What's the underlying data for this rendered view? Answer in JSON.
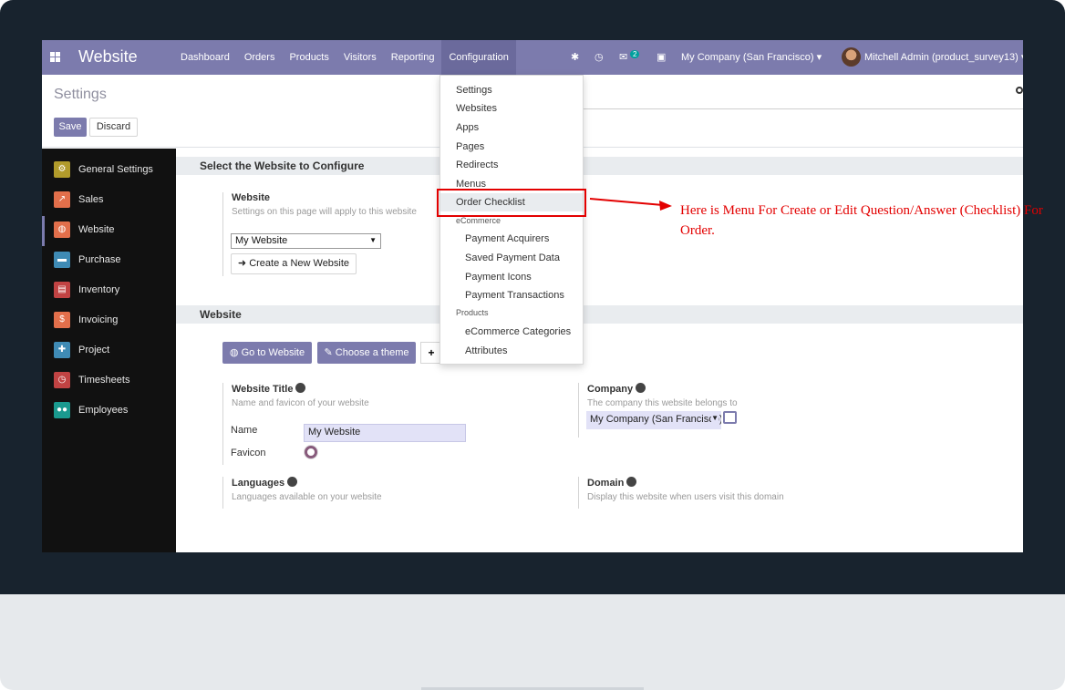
{
  "navbar": {
    "brand": "Website",
    "menus": [
      "Dashboard",
      "Orders",
      "Products",
      "Visitors",
      "Reporting",
      "Configuration"
    ],
    "active_menu": "Configuration",
    "chat_badge": "2",
    "company": "My Company (San Francisco)",
    "user": "Mitchell Admin (product_survey13)"
  },
  "control_panel": {
    "title": "Settings",
    "save_label": "Save",
    "discard_label": "Discard"
  },
  "sidebar": {
    "items": [
      {
        "label": "General Settings",
        "color": "#b19b2b",
        "icon": "gear-icon"
      },
      {
        "label": "Sales",
        "color": "#e26f4b",
        "icon": "chart-icon"
      },
      {
        "label": "Website",
        "color": "#e26f4b",
        "icon": "globe-icon"
      },
      {
        "label": "Purchase",
        "color": "#3f8bb5",
        "icon": "card-icon"
      },
      {
        "label": "Inventory",
        "color": "#c14343",
        "icon": "box-icon"
      },
      {
        "label": "Invoicing",
        "color": "#e26f4b",
        "icon": "dollar-icon"
      },
      {
        "label": "Project",
        "color": "#3f8bb5",
        "icon": "puzzle-icon"
      },
      {
        "label": "Timesheets",
        "color": "#c14343",
        "icon": "clock-icon"
      },
      {
        "label": "Employees",
        "color": "#1a9a8f",
        "icon": "people-icon"
      }
    ],
    "active": "Website"
  },
  "main": {
    "section1_title": "Select the Website to Configure",
    "website_field_title": "Website",
    "website_field_help": "Settings on this page will apply to this website",
    "website_select_value": "My Website",
    "create_button": "Create a New Website",
    "section2_title": "Website",
    "go_button": "Go to Website",
    "theme_button": "Choose a theme",
    "title_field": "Website Title",
    "title_help": "Name and favicon of your website",
    "name_label": "Name",
    "name_value": "My Website",
    "favicon_label": "Favicon",
    "company_field": "Company",
    "company_help": "The company this website belongs to",
    "company_value": "My Company (San Francisco)",
    "languages_field": "Languages",
    "languages_help": "Languages available on your website",
    "domain_field": "Domain",
    "domain_help": "Display this website when users visit this domain"
  },
  "dropdown": {
    "items": [
      "Settings",
      "Websites",
      "Apps",
      "Pages",
      "Redirects",
      "Menus",
      "Order Checklist"
    ],
    "ecommerce_header": "eCommerce",
    "ecommerce_items": [
      "Payment Acquirers",
      "Saved Payment Data",
      "Payment Icons",
      "Payment Transactions"
    ],
    "products_header": "Products",
    "products_items": [
      "eCommerce Categories",
      "Attributes"
    ]
  },
  "annotation": {
    "text": "Here is Menu For Create or Edit Question/Answer (Checklist) For Order.",
    "color": "#e30000"
  }
}
